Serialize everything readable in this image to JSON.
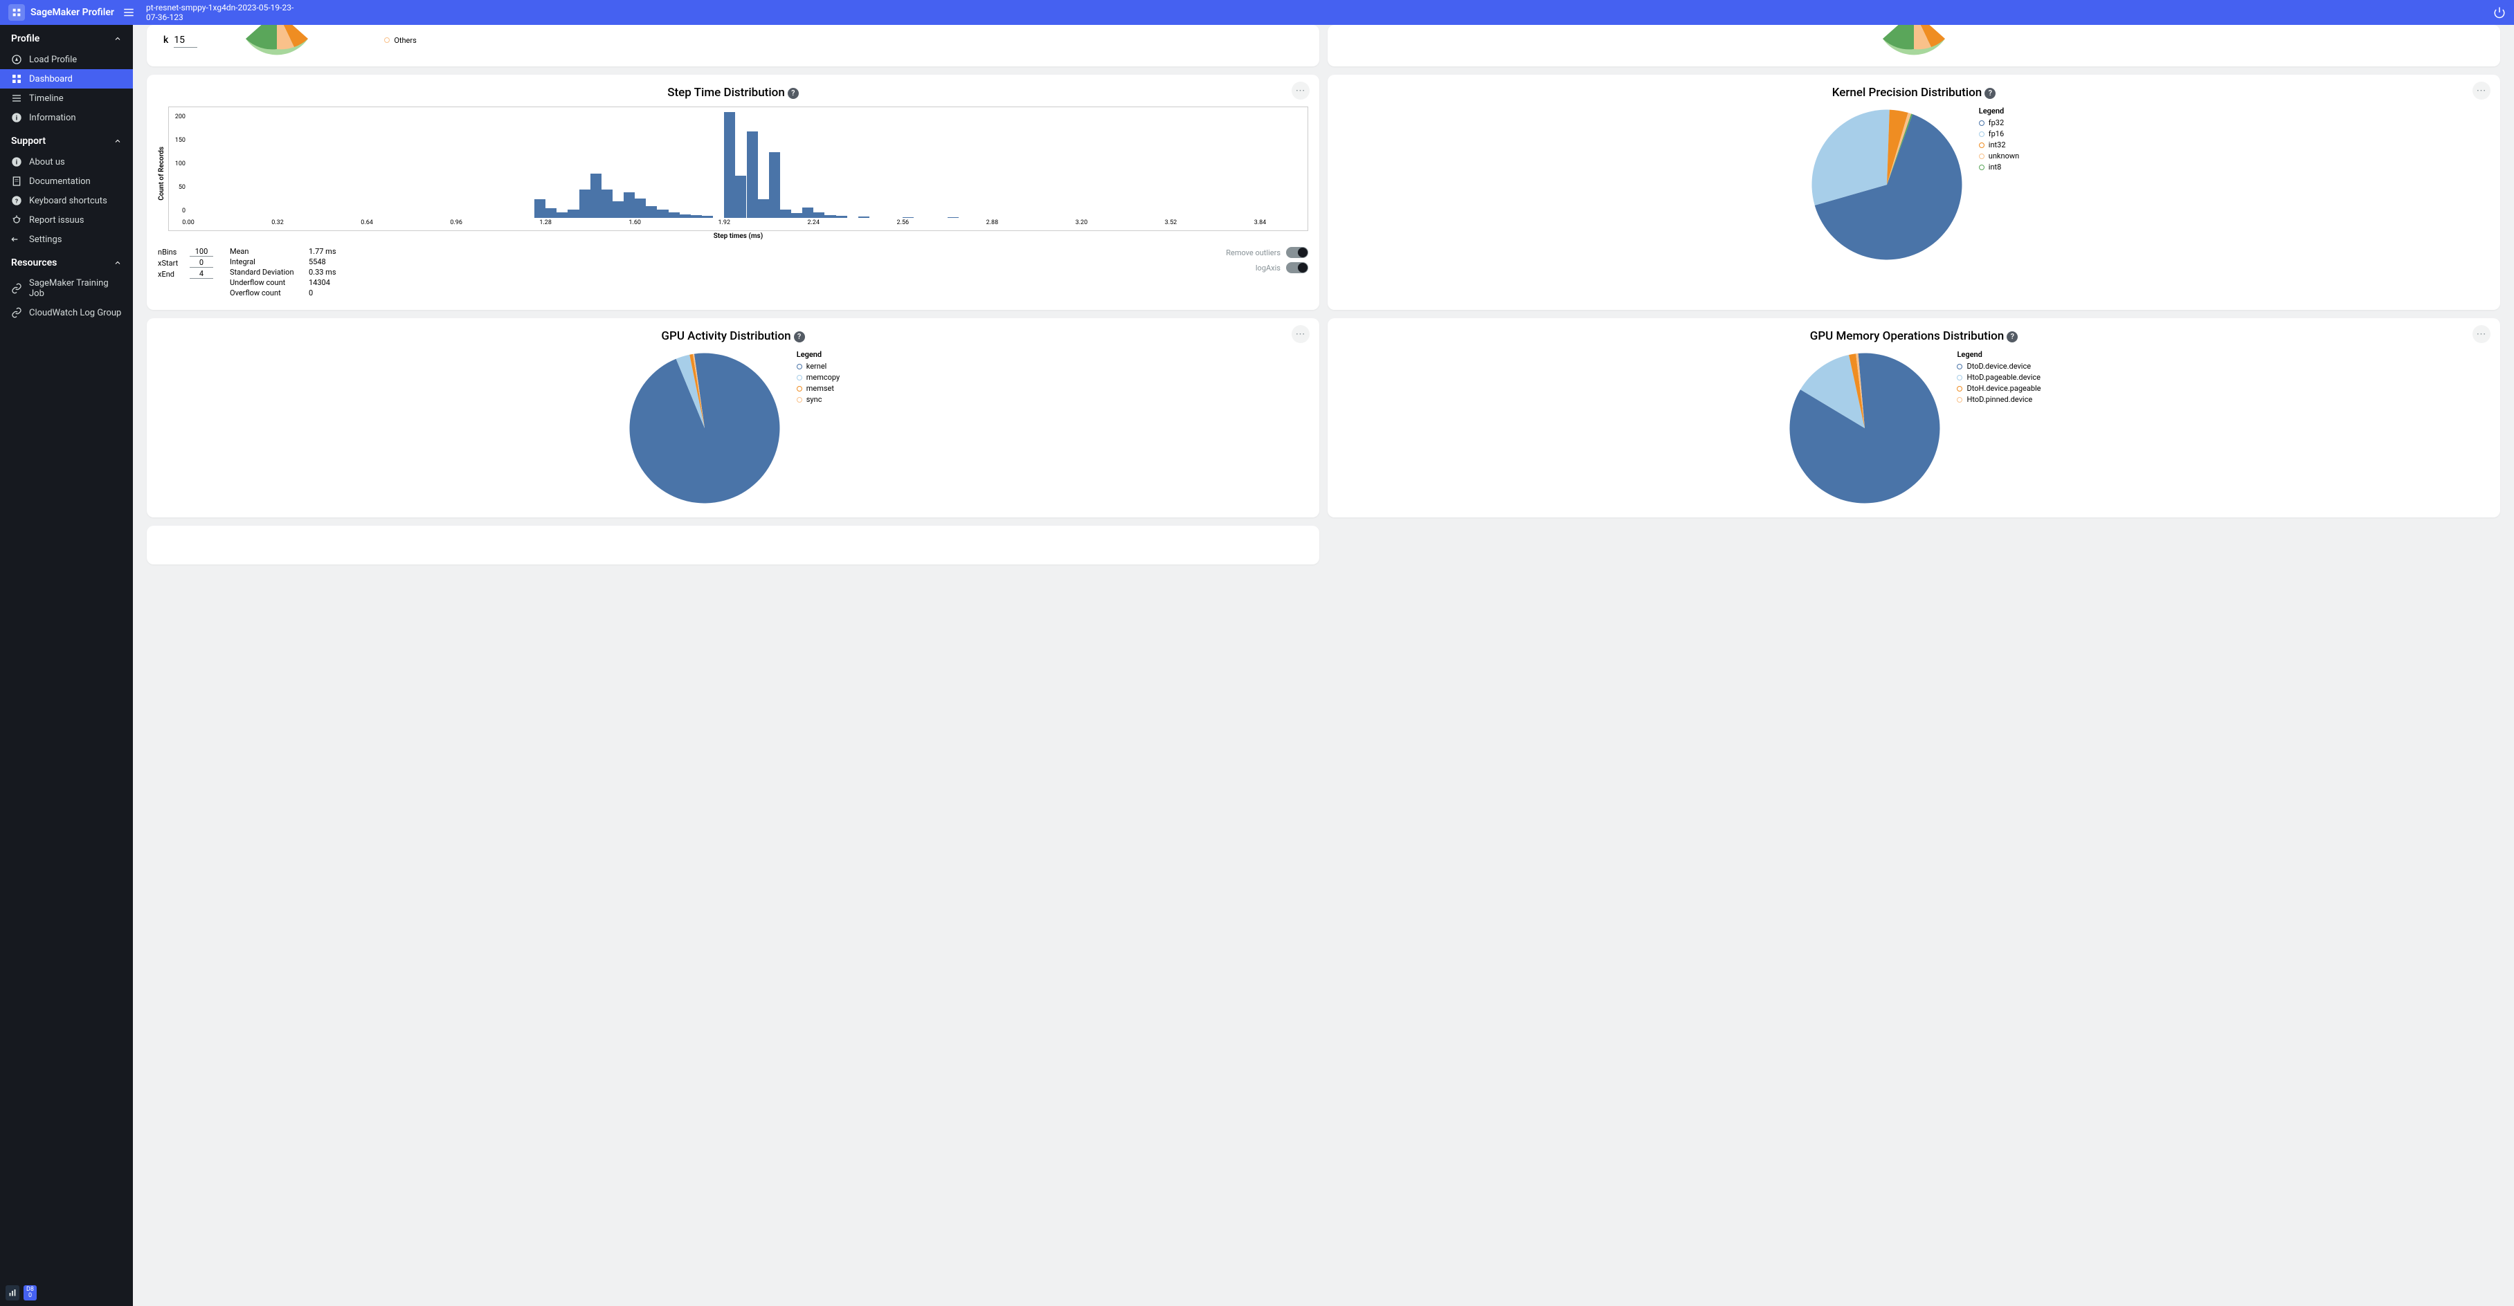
{
  "header": {
    "app_name": "SageMaker Profiler",
    "job_name": "pt-resnet-smppy-1xg4dn-2023-05-19-23-07-36-123"
  },
  "sidebar": {
    "sections": [
      {
        "title": "Profile",
        "items": [
          {
            "label": "Load Profile",
            "icon": "compass"
          },
          {
            "label": "Dashboard",
            "icon": "dashboard",
            "active": true
          },
          {
            "label": "Timeline",
            "icon": "timeline"
          },
          {
            "label": "Information",
            "icon": "info"
          }
        ]
      },
      {
        "title": "Support",
        "items": [
          {
            "label": "About us",
            "icon": "info"
          },
          {
            "label": "Documentation",
            "icon": "doc"
          },
          {
            "label": "Keyboard shortcuts",
            "icon": "help"
          },
          {
            "label": "Report issuus",
            "icon": "bug"
          },
          {
            "label": "Settings",
            "icon": "settings"
          }
        ]
      },
      {
        "title": "Resources",
        "items": [
          {
            "label": "SageMaker Training Job",
            "icon": "link"
          },
          {
            "label": "CloudWatch Log Group",
            "icon": "link"
          }
        ]
      }
    ],
    "bottom_badge": {
      "line1": "D8",
      "line2": "0"
    }
  },
  "partial_top": {
    "left": {
      "k_label": "k",
      "k_value": "15",
      "legend_others": "Others"
    },
    "right": {}
  },
  "step_time": {
    "title": "Step Time Distribution",
    "y_axis_label": "Count of Records",
    "x_axis_label": "Step times (ms)",
    "controls": {
      "nBins_label": "nBins",
      "nBins": "100",
      "xStart_label": "xStart",
      "xStart": "0",
      "xEnd_label": "xEnd",
      "xEnd": "4",
      "remove_outliers": "Remove outliers",
      "log_axis": "logAxis"
    },
    "stats": {
      "mean_label": "Mean",
      "mean": "1.77 ms",
      "integral_label": "Integral",
      "integral": "5548",
      "std_label": "Standard Deviation",
      "std": "0.33 ms",
      "underflow_label": "Underflow count",
      "underflow": "14304",
      "overflow_label": "Overflow count",
      "overflow": "0"
    }
  },
  "kernel_precision": {
    "title": "Kernel Precision Distribution",
    "legend_title": "Legend",
    "legend": [
      "fp32",
      "fp16",
      "int32",
      "unknown",
      "int8"
    ],
    "colors": [
      "#4a74a8",
      "#a7cee9",
      "#ef8d22",
      "#f9c18a",
      "#5aa65a"
    ]
  },
  "gpu_activity": {
    "title": "GPU Activity Distribution",
    "legend_title": "Legend",
    "legend": [
      "kernel",
      "memcopy",
      "memset",
      "sync"
    ],
    "colors": [
      "#4a74a8",
      "#a7cee9",
      "#ef8d22",
      "#f9c18a"
    ]
  },
  "gpu_memops": {
    "title": "GPU Memory Operations Distribution",
    "legend_title": "Legend",
    "legend": [
      "DtoD.device.device",
      "HtoD.pageable.device",
      "DtoH.device.pageable",
      "HtoD.pinned.device"
    ],
    "colors": [
      "#4a74a8",
      "#a7cee9",
      "#ef8d22",
      "#f9c18a"
    ]
  },
  "chart_data": [
    {
      "type": "bar",
      "name": "Step Time Distribution",
      "xlabel": "Step times (ms)",
      "ylabel": "Count of Records",
      "xlim": [
        0,
        4
      ],
      "ylim": [
        0,
        230
      ],
      "y_ticks": [
        0,
        50,
        100,
        150,
        200
      ],
      "x_ticks": [
        0.0,
        0.32,
        0.64,
        0.96,
        1.28,
        1.6,
        1.92,
        2.24,
        2.56,
        2.88,
        3.2,
        3.52,
        3.84
      ],
      "bars": [
        {
          "x": 1.24,
          "y": 40
        },
        {
          "x": 1.28,
          "y": 20
        },
        {
          "x": 1.32,
          "y": 12
        },
        {
          "x": 1.36,
          "y": 18
        },
        {
          "x": 1.4,
          "y": 60
        },
        {
          "x": 1.44,
          "y": 95
        },
        {
          "x": 1.48,
          "y": 60
        },
        {
          "x": 1.52,
          "y": 35
        },
        {
          "x": 1.56,
          "y": 55
        },
        {
          "x": 1.6,
          "y": 42
        },
        {
          "x": 1.64,
          "y": 25
        },
        {
          "x": 1.68,
          "y": 18
        },
        {
          "x": 1.72,
          "y": 12
        },
        {
          "x": 1.76,
          "y": 8
        },
        {
          "x": 1.8,
          "y": 6
        },
        {
          "x": 1.84,
          "y": 4
        },
        {
          "x": 1.92,
          "y": 225
        },
        {
          "x": 1.96,
          "y": 90
        },
        {
          "x": 2.0,
          "y": 185
        },
        {
          "x": 2.04,
          "y": 40
        },
        {
          "x": 2.08,
          "y": 140
        },
        {
          "x": 2.12,
          "y": 18
        },
        {
          "x": 2.16,
          "y": 10
        },
        {
          "x": 2.2,
          "y": 22
        },
        {
          "x": 2.24,
          "y": 12
        },
        {
          "x": 2.28,
          "y": 6
        },
        {
          "x": 2.32,
          "y": 4
        },
        {
          "x": 2.4,
          "y": 3
        },
        {
          "x": 2.56,
          "y": 2
        },
        {
          "x": 2.72,
          "y": 2
        }
      ]
    },
    {
      "type": "pie",
      "name": "Kernel Precision Distribution",
      "series": [
        {
          "name": "fp32",
          "value": 65,
          "color": "#4a74a8"
        },
        {
          "name": "fp16",
          "value": 30,
          "color": "#a7cee9"
        },
        {
          "name": "int32",
          "value": 4,
          "color": "#ef8d22"
        },
        {
          "name": "unknown",
          "value": 0.7,
          "color": "#f9c18a"
        },
        {
          "name": "int8",
          "value": 0.3,
          "color": "#5aa65a"
        }
      ]
    },
    {
      "type": "pie",
      "name": "GPU Activity Distribution",
      "series": [
        {
          "name": "kernel",
          "value": 96,
          "color": "#4a74a8"
        },
        {
          "name": "memcopy",
          "value": 3,
          "color": "#a7cee9"
        },
        {
          "name": "memset",
          "value": 0.7,
          "color": "#ef8d22"
        },
        {
          "name": "sync",
          "value": 0.3,
          "color": "#f9c18a"
        }
      ]
    },
    {
      "type": "pie",
      "name": "GPU Memory Operations Distribution",
      "series": [
        {
          "name": "DtoD.device.device",
          "value": 85,
          "color": "#4a74a8"
        },
        {
          "name": "HtoD.pageable.device",
          "value": 13,
          "color": "#a7cee9"
        },
        {
          "name": "DtoH.device.pageable",
          "value": 1.5,
          "color": "#ef8d22"
        },
        {
          "name": "HtoD.pinned.device",
          "value": 0.5,
          "color": "#f9c18a"
        }
      ]
    }
  ]
}
